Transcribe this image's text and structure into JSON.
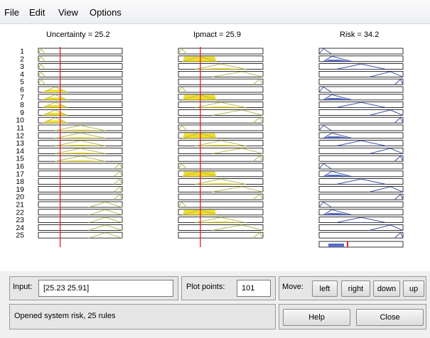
{
  "menu": {
    "file": "File",
    "edit": "Edit",
    "view": "View",
    "options": "Options"
  },
  "headers": {
    "uncertainty": "Uncertainty = 25.2",
    "impact": "Ipmact = 25.9",
    "risk": "Risk = 34.2"
  },
  "rules": [
    "1",
    "2",
    "3",
    "4",
    "5",
    "6",
    "7",
    "8",
    "9",
    "10",
    "11",
    "12",
    "13",
    "14",
    "15",
    "16",
    "17",
    "18",
    "19",
    "20",
    "21",
    "22",
    "23",
    "24",
    "25"
  ],
  "colors": {
    "input_fill": "#f1dd2a",
    "input_line": "#b8b85a",
    "output_line": "#3c4fa5",
    "output_fill": "#5a6dc6",
    "marker": "#e0201f"
  },
  "input": {
    "label": "Input:",
    "value": "[25.23 25.91]"
  },
  "plot_points": {
    "label": "Plot points:",
    "value": "101"
  },
  "move": {
    "label": "Move:",
    "left": "left",
    "right": "right",
    "down": "down",
    "up": "up"
  },
  "status": "Opened system risk, 25 rules",
  "buttons": {
    "help": "Help",
    "close": "Close"
  }
}
